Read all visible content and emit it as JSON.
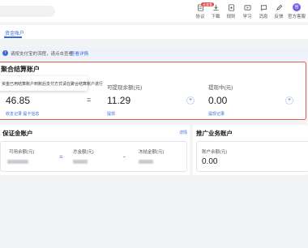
{
  "nav": {
    "items": [
      {
        "label": "协议",
        "icon": "document-icon",
        "badge": "去查看"
      },
      {
        "label": "下载",
        "icon": "download-icon"
      },
      {
        "label": "规则",
        "icon": "rules-icon"
      },
      {
        "label": "学习",
        "icon": "learn-icon"
      },
      {
        "label": "消息",
        "icon": "message-icon"
      },
      {
        "label": "反馈",
        "icon": "feedback-icon"
      },
      {
        "label": "官方客服",
        "icon": "service-icon",
        "avatar": "官"
      }
    ]
  },
  "tabs": {
    "active": "资金账户"
  },
  "notice": {
    "text": "请按支付宝的流程，请点击查看",
    "link": "查看详情",
    "icon": "i"
  },
  "settlement": {
    "title": "聚合结算账户",
    "tooltip": "资金已用结算账户到账后支付方式请在聚合结算账户进行",
    "balance_value": "46.85",
    "balance_links": "收支记录  提卡信息",
    "op1": "=",
    "withdrawable_label": "可提现余额(元)",
    "withdrawable_value": "11.29",
    "withdrawable_link": "提现",
    "op2": "+",
    "withdrawing_label": "提现中(元)",
    "withdrawing_value": "0.00",
    "withdrawing_link": "提现记录",
    "op3": "+"
  },
  "deposit": {
    "title": "保证金账户",
    "link": "详情",
    "available_label": "可用余额(元)",
    "eq": "=",
    "total_label": "总金额(元)",
    "minus": "-",
    "frozen_label": "冻结金额(元)"
  },
  "promo": {
    "title": "推广业务账户",
    "balance_label": "账户余额(元)",
    "balance_value": "0.00"
  },
  "colors": {
    "accent": "#3b6bd8",
    "highlight_border": "#e45b4e",
    "badge": "#e6454a"
  }
}
